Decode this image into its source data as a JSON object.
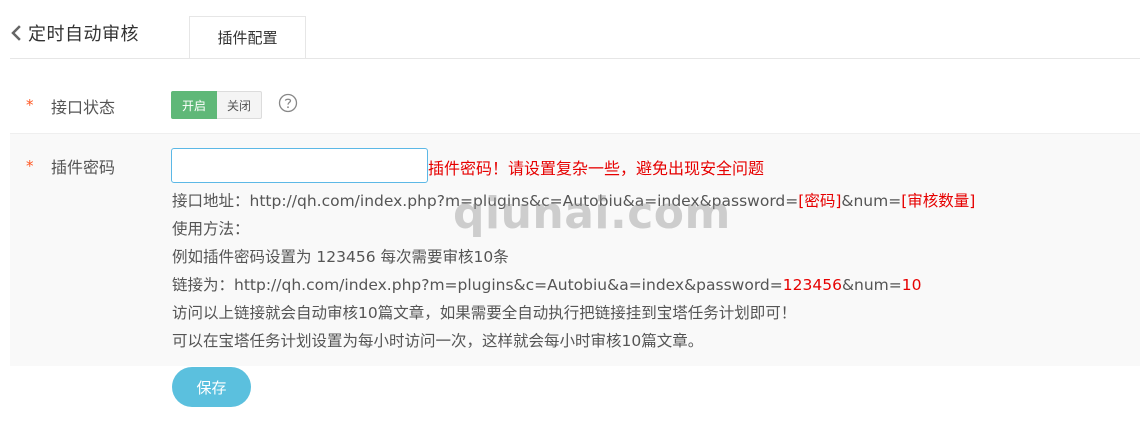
{
  "header": {
    "back_icon": "chevron-left-icon",
    "title": "定时自动审核",
    "tab_label": "插件配置"
  },
  "form": {
    "status": {
      "label": "接口状态",
      "required_mark": "*",
      "on_label": "开启",
      "off_label": "关闭",
      "selected": "开启",
      "on_color": "#5FB878",
      "help_icon": "question-circle-icon"
    },
    "password": {
      "label": "插件密码",
      "required_mark": "*",
      "value": "",
      "placeholder": "",
      "warning": "插件密码！请设置复杂一些，避免出现安全问题",
      "warning_color": "#e60000"
    },
    "info": {
      "api_prefix": "接口地址：http://qh.com/index.php?m=plugins&c=Autobiu&a=index&password=",
      "api_pw": "[密码]",
      "api_mid": "&num=",
      "api_num": "[审核数量]",
      "usage": "使用方法：",
      "example": "例如插件密码设置为 123456 每次需要审核10条",
      "link_prefix": "链接为：http://qh.com/index.php?m=plugins&c=Autobiu&a=index&password=",
      "link_pw": "123456",
      "link_mid": "&num=",
      "link_num": "10",
      "note1": "访问以上链接就会自动审核10篇文章，如果需要全自动执行把链接挂到宝塔任务计划即可！",
      "note2": "可以在宝塔任务计划设置为每小时访问一次，这样就会每小时审核10篇文章。"
    },
    "save_label": "保存",
    "save_color": "#5bc0de"
  },
  "watermark": "qiunai.com"
}
